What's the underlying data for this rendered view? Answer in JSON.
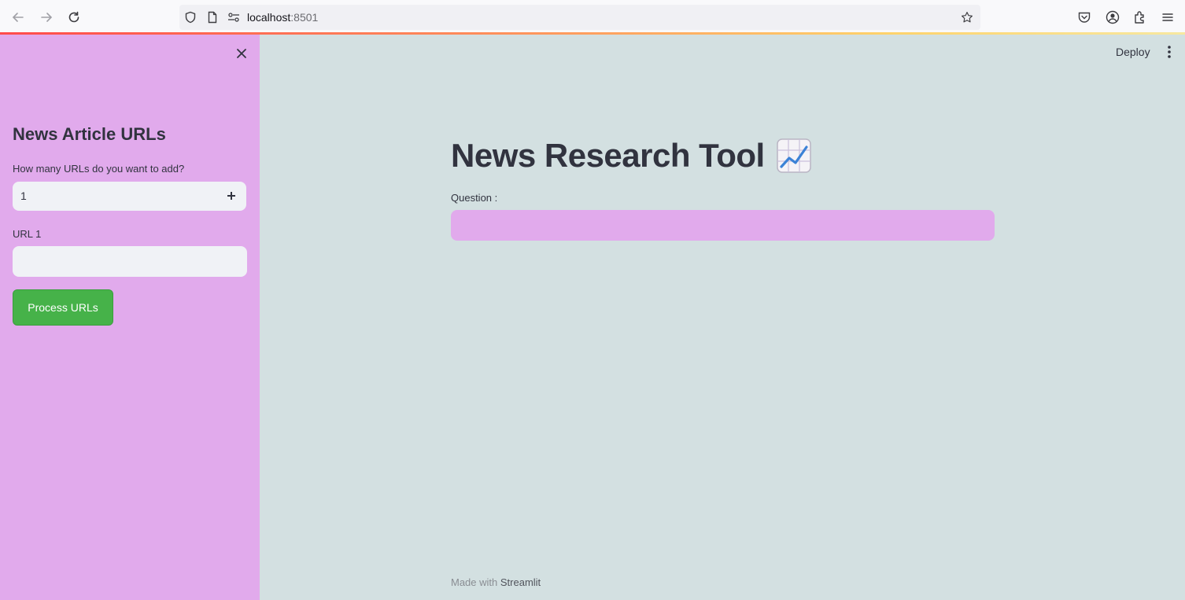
{
  "browser": {
    "url_host": "localhost",
    "url_port": ":8501",
    "icons": [
      "back-arrow-icon",
      "forward-arrow-icon",
      "reload-icon",
      "shield-icon",
      "page-icon",
      "permissions-icon",
      "bookmark-star-icon",
      "pocket-icon",
      "account-icon",
      "extensions-icon",
      "menu-icon"
    ]
  },
  "sidebar": {
    "title": "News Article URLs",
    "count_label": "How many URLs do you want to add?",
    "count_value": "1",
    "url_label": "URL 1",
    "url_value": "",
    "process_button": "Process URLs",
    "bg_color": "#e1aaec"
  },
  "header": {
    "deploy_label": "Deploy"
  },
  "main": {
    "title": "News Research Tool",
    "title_emoji": "chart-increasing-icon",
    "question_label": "Question :",
    "question_value": "",
    "bg_color": "#d3e0e1"
  },
  "footer": {
    "prefix": "Made with ",
    "brand": "Streamlit"
  },
  "colors": {
    "accent_button": "#46b249",
    "text": "#31333f"
  }
}
